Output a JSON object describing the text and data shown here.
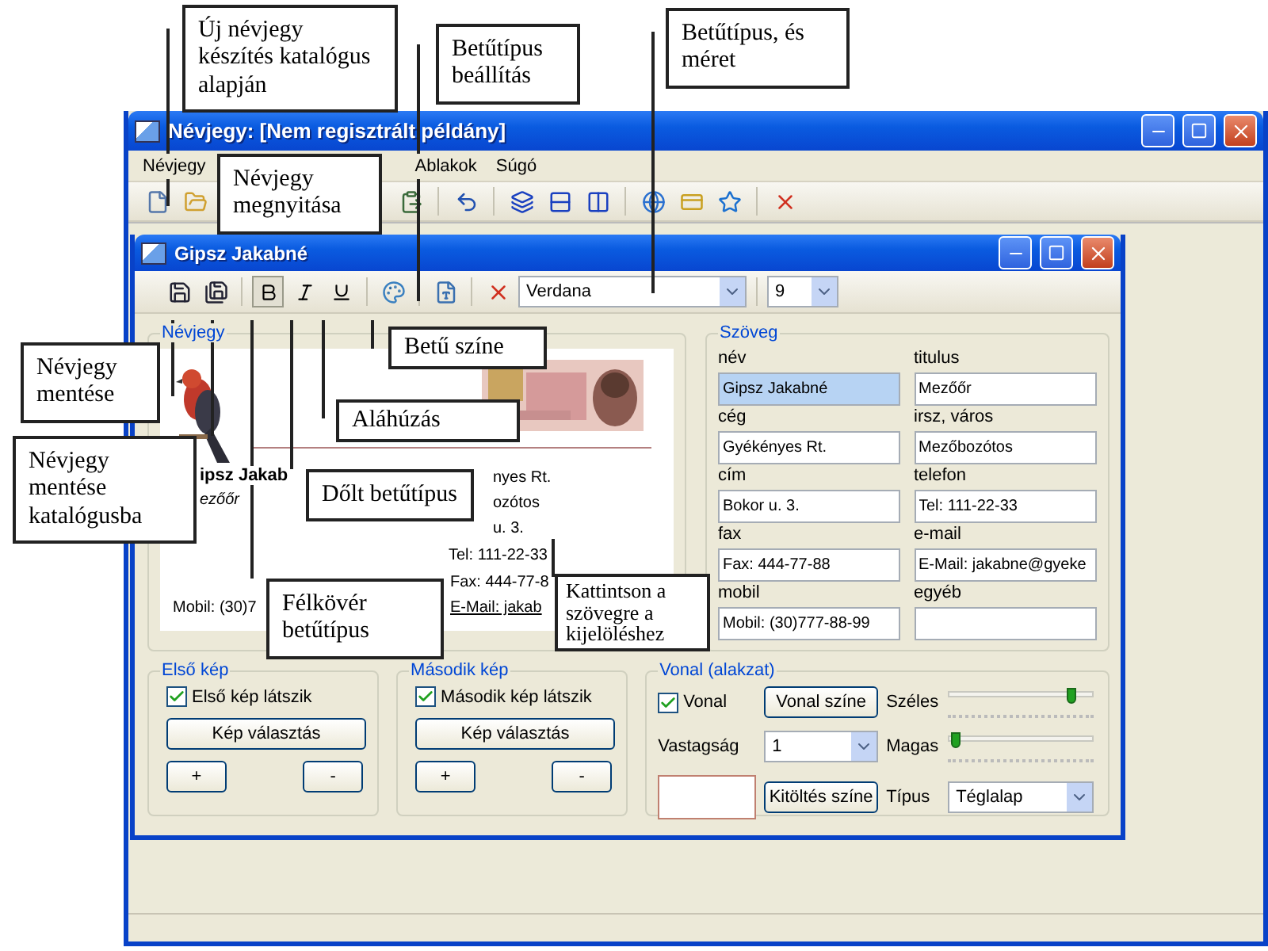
{
  "main_window": {
    "title": "Névjegy: [Nem regisztrált példány]",
    "menu": [
      "Névjegy",
      "Ablakok",
      "Súgó"
    ]
  },
  "document_window": {
    "title": "Gipsz Jakabné",
    "font": "Verdana",
    "font_size": "9",
    "card": {
      "title": "Névjegy",
      "texts": [
        {
          "kind": "name",
          "text": "ipsz Jakab"
        },
        {
          "kind": "title",
          "text": "ezőőr"
        },
        {
          "kind": "company",
          "text": "nyes Rt."
        },
        {
          "kind": "city",
          "text": "ozótos"
        },
        {
          "kind": "address",
          "text": "u. 3."
        },
        {
          "kind": "phone",
          "text": "Tel: 111-22-33"
        },
        {
          "kind": "fax",
          "text": "Fax: 444-77-8"
        },
        {
          "kind": "mobile",
          "text": "Mobil: (30)7"
        },
        {
          "kind": "email",
          "text": "E-Mail: jakab"
        }
      ]
    },
    "text_group": {
      "title": "Szöveg",
      "fields": [
        {
          "label": "név",
          "value": "Gipsz Jakabné",
          "selected": true
        },
        {
          "label": "titulus",
          "value": "Mezőőr",
          "selected": false
        },
        {
          "label": "cég",
          "value": "Gyékényes Rt.",
          "selected": false
        },
        {
          "label": "irsz, város",
          "value": "Mezőbozótos",
          "selected": false
        },
        {
          "label": "cím",
          "value": "Bokor u. 3.",
          "selected": false
        },
        {
          "label": "telefon",
          "value": "Tel: 111-22-33",
          "selected": false
        },
        {
          "label": "fax",
          "value": "Fax: 444-77-88",
          "selected": false
        },
        {
          "label": "e-mail",
          "value": "E-Mail: jakabne@gyeke",
          "selected": false
        },
        {
          "label": "mobil",
          "value": "Mobil: (30)777-88-99",
          "selected": false
        },
        {
          "label": "egyéb",
          "selected": false
        }
      ]
    },
    "picture_groups": [
      {
        "title": "Első kép",
        "checkbox": "Első kép látszik",
        "checked": true,
        "button": "Kép választás",
        "plus": "+",
        "minus": "-"
      },
      {
        "title": "Második kép",
        "checkbox": "Második kép látszik",
        "checked": true,
        "button": "Kép választás",
        "plus": "+",
        "minus": "-"
      }
    ],
    "line_group": {
      "title": "Vonal (alakzat)",
      "checkbox": "Vonal",
      "checked": true,
      "line_color_button": "Vonal színe",
      "width_slider": {
        "label": "Széles",
        "level": 0.85
      },
      "thickness_label": "Vastagság",
      "thickness": "1",
      "height_slider": {
        "label": "Magas",
        "level": 0.02
      },
      "fill_color_button": "Kitöltés színe",
      "type_label": "Típus",
      "type": "Téglalap"
    }
  },
  "callouts": [
    {
      "text": "Új névjegy készítés katalógus alapján"
    },
    {
      "text": "Betűtípus beállítás"
    },
    {
      "text": "Betűtípus, és méret"
    },
    {
      "text": "Névjegy megnyitása"
    },
    {
      "text": "Névjegy mentése"
    },
    {
      "text": "Névjegy mentése katalógusba"
    },
    {
      "text": "Betű színe"
    },
    {
      "text": "Aláhúzás"
    },
    {
      "text": "Dőlt betűtípus"
    },
    {
      "text": "Félkövér betűtípus"
    },
    {
      "text": "Kattintson a szövegre a kijelöléshez"
    }
  ]
}
